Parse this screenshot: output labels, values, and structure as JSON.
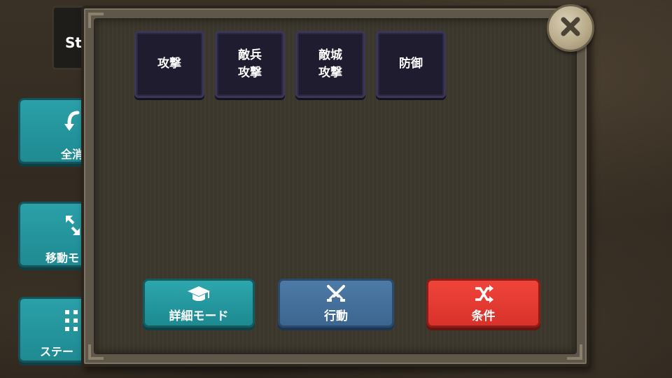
{
  "background": {
    "tab_text": "St",
    "side_buttons": [
      {
        "label": "全消",
        "icon": "undo-arrow-icon"
      },
      {
        "label": "移動モ",
        "icon": "expand-arrows-icon"
      },
      {
        "label": "ステー",
        "icon": "grid-dots-icon"
      }
    ]
  },
  "dialog": {
    "commands": [
      {
        "label": "攻撃"
      },
      {
        "label": "敵兵\n攻撃"
      },
      {
        "label": "敵城\n攻撃"
      },
      {
        "label": "防御"
      }
    ],
    "actions": {
      "detail": {
        "label": "詳細モード",
        "icon": "graduation-cap-icon",
        "color": "#1d8990"
      },
      "action": {
        "label": "行動",
        "icon": "crossed-swords-icon",
        "color": "#3c6690"
      },
      "condition": {
        "label": "条件",
        "icon": "shuffle-icon",
        "color": "#d8322a"
      }
    },
    "close": {
      "icon": "close-icon"
    }
  }
}
